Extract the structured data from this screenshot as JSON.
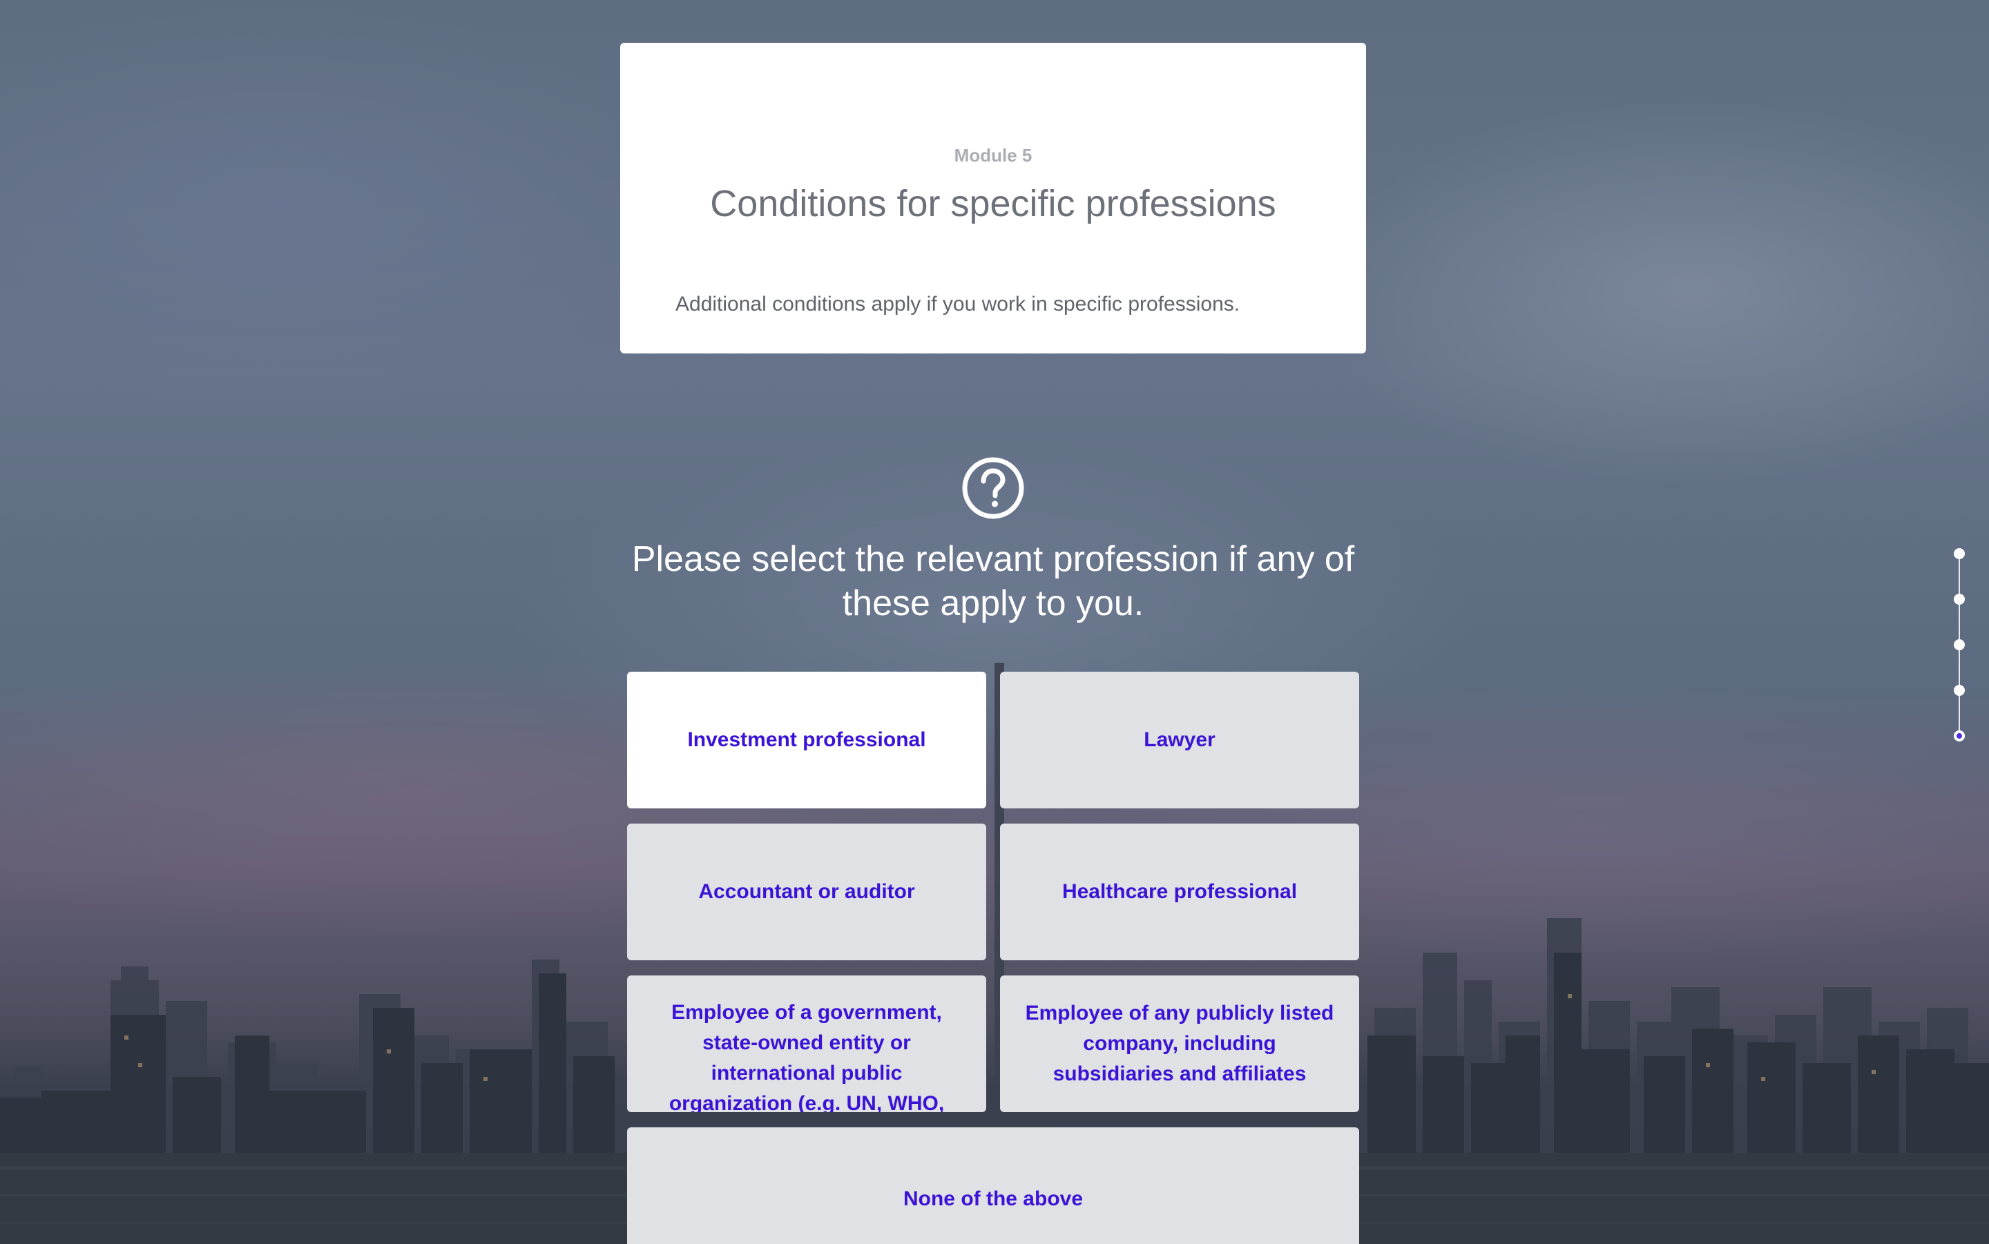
{
  "module": {
    "label": "Module 5",
    "title": "Conditions for specific professions",
    "description": "Additional conditions apply if you work in specific professions."
  },
  "question": {
    "icon": "question-circle-icon",
    "text": "Please select the relevant profession if any of these apply to you."
  },
  "options": [
    {
      "label": "Investment professional",
      "selected": true
    },
    {
      "label": "Lawyer",
      "selected": false
    },
    {
      "label": "Accountant or auditor",
      "selected": false
    },
    {
      "label": "Healthcare professional",
      "selected": false
    },
    {
      "label": "Employee of a government, state-owned entity or international public organization (e.g. UN, WHO, etc.)",
      "selected": false
    },
    {
      "label": "Employee of any publicly listed company, including subsidiaries and affiliates",
      "selected": false
    },
    {
      "label": "None of the above",
      "selected": false
    }
  ],
  "step_nav": {
    "total_steps": 5,
    "active_step": 5
  },
  "colors": {
    "option_text": "#3b13d6",
    "option_bg": "#dfe1e5",
    "option_selected_bg": "#ffffff",
    "active_step": "#4a2ee6"
  }
}
